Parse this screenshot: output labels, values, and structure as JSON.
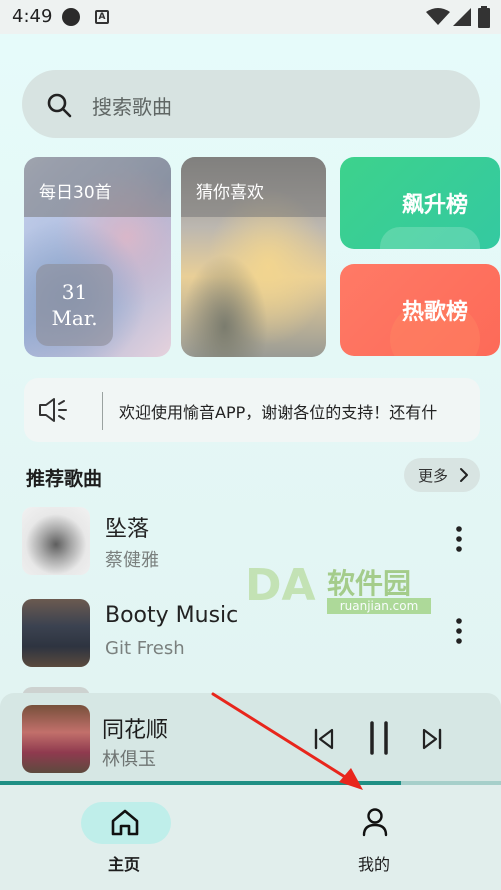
{
  "status_bar": {
    "time": "4:49",
    "a_label": "A"
  },
  "search": {
    "placeholder": "搜索歌曲"
  },
  "cards": {
    "daily": {
      "title": "每日30首",
      "day": "31",
      "month": "Mar."
    },
    "guess": {
      "title": "猜你喜欢"
    }
  },
  "ranks": [
    {
      "label": "飙升榜",
      "color": "#3dd28c"
    },
    {
      "label": "热歌榜",
      "color": "#ff7a66"
    }
  ],
  "notice": {
    "text": "欢迎使用愉音APP，谢谢各位的支持！还有什"
  },
  "recommend": {
    "title": "推荐歌曲",
    "more_label": "更多"
  },
  "songs": [
    {
      "title": "坠落",
      "artist": "蔡健雅"
    },
    {
      "title": "Booty Music",
      "artist": "Git Fresh"
    }
  ],
  "watermark": {
    "big": "DA",
    "cn": "软件园",
    "en": "ruanjian.com"
  },
  "player": {
    "title": "同花顺",
    "artist": "林俱玉",
    "progress": 0.8
  },
  "nav": [
    {
      "label": "主页",
      "active": true
    },
    {
      "label": "我的",
      "active": false
    }
  ],
  "colors": {
    "accent": "#1f8f84",
    "arrow": "#e8261c"
  }
}
